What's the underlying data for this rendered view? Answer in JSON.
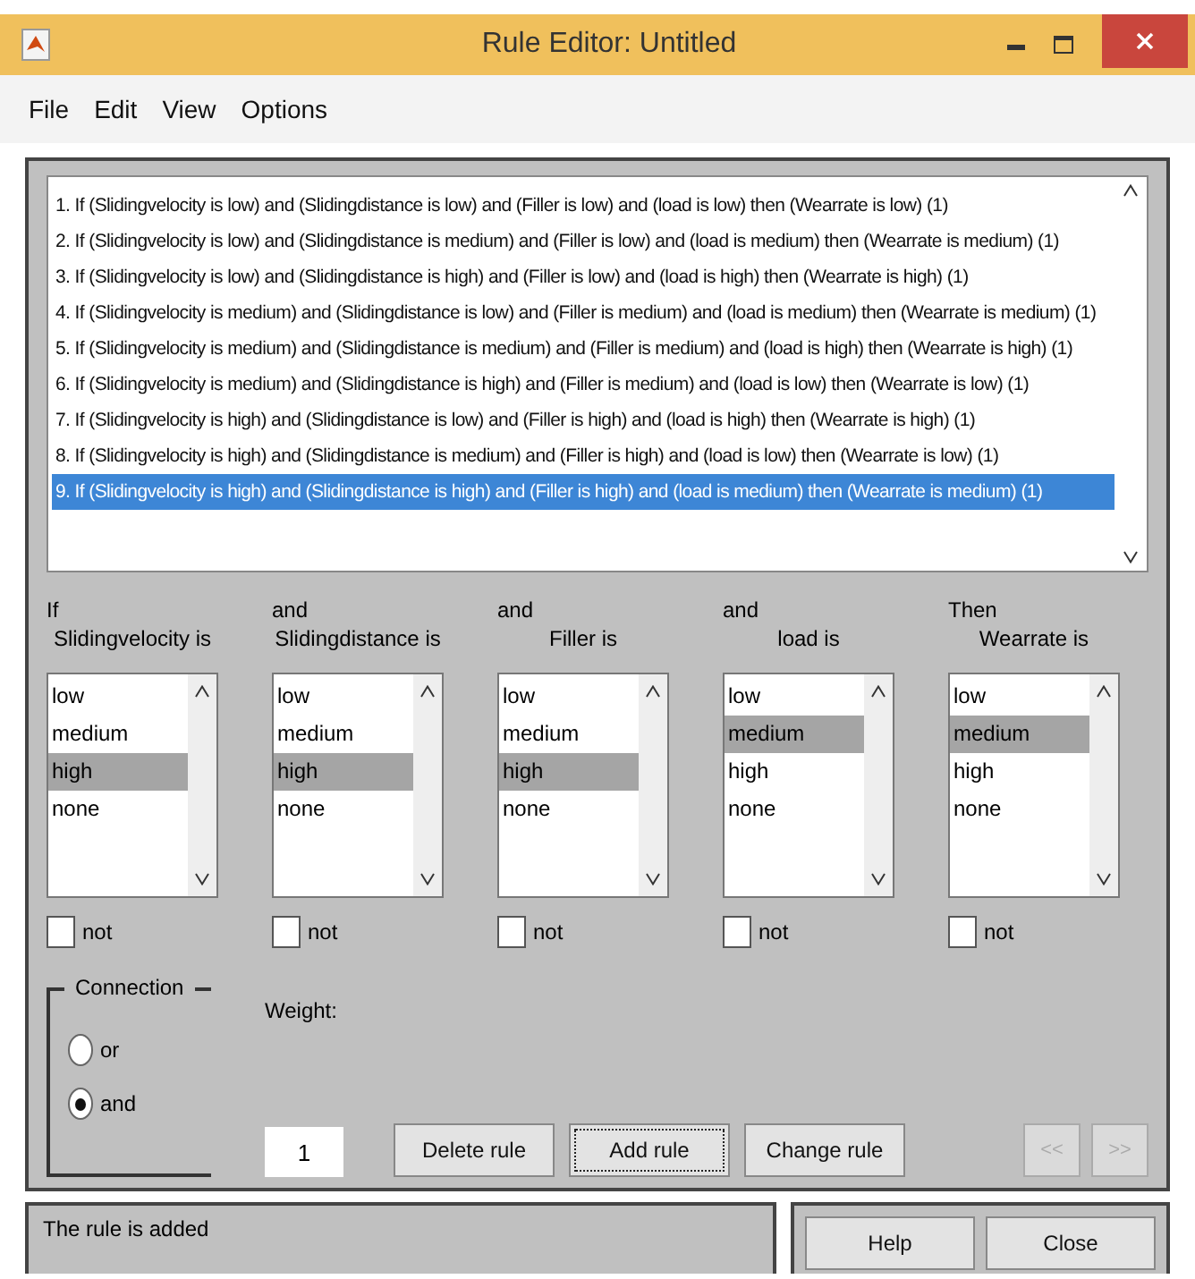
{
  "window": {
    "title": "Rule Editor: Untitled"
  },
  "menu": [
    "File",
    "Edit",
    "View",
    "Options"
  ],
  "rules": [
    {
      "text": "1. If (Slidingvelocity is low) and (Slidingdistance is low) and (Filler is low) and (load is low) then (Wearrate is low) (1)",
      "selected": false
    },
    {
      "text": "2. If (Slidingvelocity is low) and (Slidingdistance is medium) and (Filler is low) and (load is medium) then (Wearrate is medium) (1)",
      "selected": false
    },
    {
      "text": "3. If (Slidingvelocity is low) and (Slidingdistance is high) and (Filler is low) and (load is high) then (Wearrate is high) (1)",
      "selected": false
    },
    {
      "text": "4. If (Slidingvelocity is medium) and (Slidingdistance is low) and (Filler is medium) and (load is medium) then (Wearrate is medium) (1)",
      "selected": false
    },
    {
      "text": "5. If (Slidingvelocity is medium) and (Slidingdistance is medium) and (Filler is medium) and (load is high) then (Wearrate is high) (1)",
      "selected": false
    },
    {
      "text": "6. If (Slidingvelocity is medium) and (Slidingdistance is high) and (Filler is medium) and (load is low) then (Wearrate is low) (1)",
      "selected": false
    },
    {
      "text": "7. If (Slidingvelocity is high) and (Slidingdistance is low) and (Filler is high) and (load is high) then (Wearrate is high) (1)",
      "selected": false
    },
    {
      "text": "8. If (Slidingvelocity is high) and (Slidingdistance is medium) and (Filler is high) and (load is low) then (Wearrate is low) (1)",
      "selected": false
    },
    {
      "text": "9. If (Slidingvelocity is high) and (Slidingdistance is high) and (Filler is high) and (load is medium) then (Wearrate is medium) (1)",
      "selected": true
    }
  ],
  "variables": [
    {
      "connector": "If",
      "label": "Slidingvelocity is",
      "options": [
        {
          "label": "low",
          "selected": false
        },
        {
          "label": "medium",
          "selected": false
        },
        {
          "label": "high",
          "selected": true
        },
        {
          "label": "none",
          "selected": false
        }
      ],
      "negate": {
        "label": "not",
        "checked": false
      }
    },
    {
      "connector": "and",
      "label": "Slidingdistance is",
      "options": [
        {
          "label": "low",
          "selected": false
        },
        {
          "label": "medium",
          "selected": false
        },
        {
          "label": "high",
          "selected": true
        },
        {
          "label": "none",
          "selected": false
        }
      ],
      "negate": {
        "label": "not",
        "checked": false
      }
    },
    {
      "connector": "and",
      "label": "Filler is",
      "options": [
        {
          "label": "low",
          "selected": false
        },
        {
          "label": "medium",
          "selected": false
        },
        {
          "label": "high",
          "selected": true
        },
        {
          "label": "none",
          "selected": false
        }
      ],
      "negate": {
        "label": "not",
        "checked": false
      }
    },
    {
      "connector": "and",
      "label": "load is",
      "options": [
        {
          "label": "low",
          "selected": false
        },
        {
          "label": "medium",
          "selected": true
        },
        {
          "label": "high",
          "selected": false
        },
        {
          "label": "none",
          "selected": false
        }
      ],
      "negate": {
        "label": "not",
        "checked": false
      }
    },
    {
      "connector": "Then",
      "label": "Wearrate is",
      "options": [
        {
          "label": "low",
          "selected": false
        },
        {
          "label": "medium",
          "selected": true
        },
        {
          "label": "high",
          "selected": false
        },
        {
          "label": "none",
          "selected": false
        }
      ],
      "negate": {
        "label": "not",
        "checked": false
      }
    }
  ],
  "connection": {
    "title": "Connection",
    "options": [
      {
        "label": "or",
        "selected": false
      },
      {
        "label": "and",
        "selected": true
      }
    ]
  },
  "weight": {
    "label": "Weight:",
    "value": "1"
  },
  "buttons": [
    {
      "label": "Delete rule",
      "focused": false
    },
    {
      "label": "Add rule",
      "focused": true
    },
    {
      "label": "Change rule",
      "focused": false
    }
  ],
  "nav": [
    {
      "label": "<<",
      "disabled": true
    },
    {
      "label": ">>",
      "disabled": true
    }
  ],
  "status": "The rule is added",
  "footer_buttons": [
    "Help",
    "Close"
  ]
}
